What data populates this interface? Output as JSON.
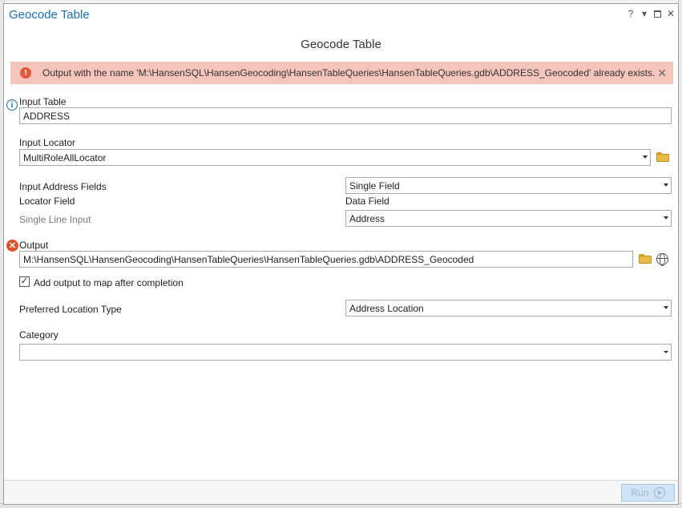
{
  "window": {
    "title": "Geocode Table",
    "help": "?",
    "menu": "▾",
    "close": "✕"
  },
  "tool": {
    "heading": "Geocode Table"
  },
  "error": {
    "message": "Output with the name 'M:\\HansenSQL\\HansenGeocoding\\HansenTableQueries\\HansenTableQueries.gdb\\ADDRESS_Geocoded' already exists.",
    "icon_glyph": "!",
    "close_glyph": "✕"
  },
  "params": {
    "input_table": {
      "label": "Input Table",
      "value": "ADDRESS",
      "icon": "info-icon",
      "icon_glyph": "i"
    },
    "input_locator": {
      "label": "Input Locator",
      "value": "MultiRoleAllLocator"
    },
    "input_address_fields": {
      "label": "Input Address Fields",
      "value": "Single Field"
    },
    "field_map": {
      "locator_field_header": "Locator Field",
      "data_field_header": "Data Field",
      "rows": [
        {
          "locator_field": "Single Line Input",
          "data_field": "Address"
        }
      ]
    },
    "output": {
      "label": "Output",
      "value": "M:\\HansenSQL\\HansenGeocoding\\HansenTableQueries\\HansenTableQueries.gdb\\ADDRESS_Geocoded",
      "icon": "error-x-icon",
      "icon_glyph": "✕"
    },
    "add_to_map": {
      "label": "Add output to map after completion",
      "checked": true,
      "check_glyph": "✓"
    },
    "preferred_location_type": {
      "label": "Preferred Location Type",
      "value": "Address Location"
    },
    "category": {
      "label": "Category",
      "value": ""
    }
  },
  "footer": {
    "run_label": "Run"
  },
  "colors": {
    "title_blue": "#1a6fb5",
    "error_bar": "#f5c4ba",
    "error_icon": "#e05b3c",
    "run_button_disabled": "#cfe3f5"
  }
}
